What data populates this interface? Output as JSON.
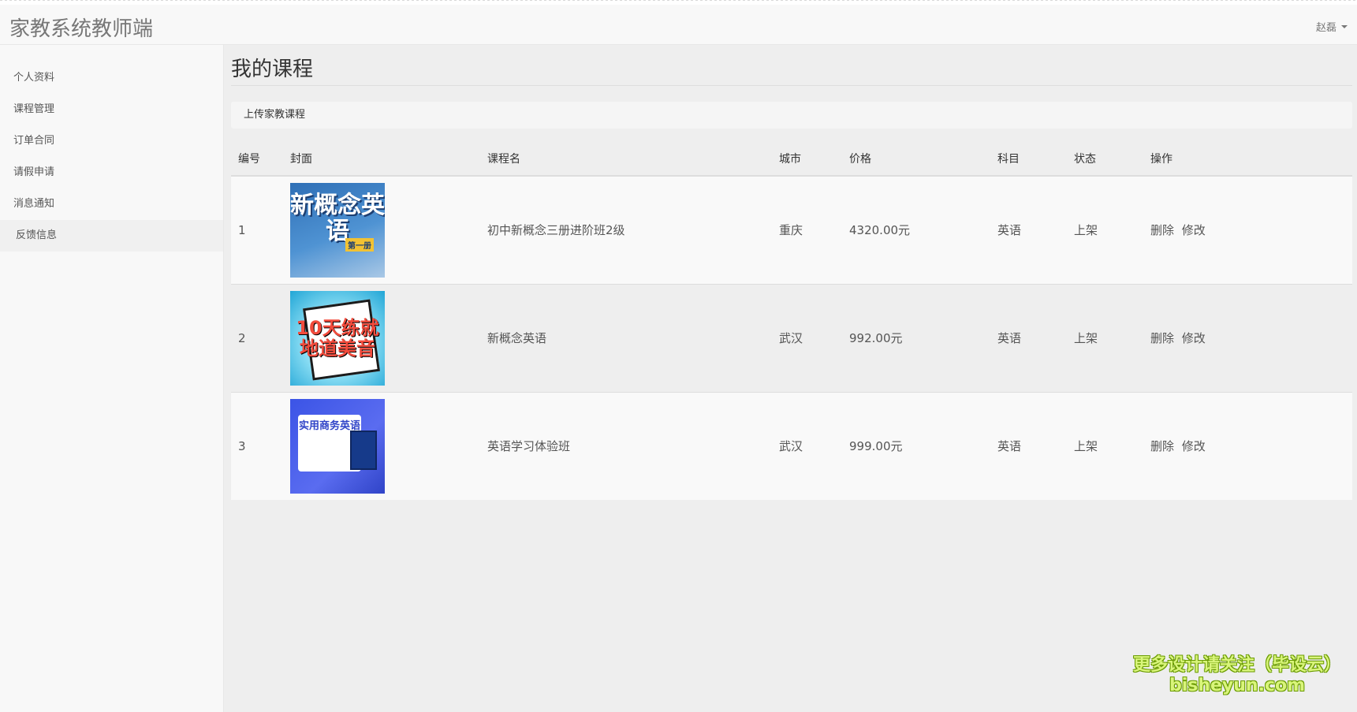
{
  "app": {
    "brand": "家教系统教师端",
    "user": "赵磊"
  },
  "sidebar": {
    "items": [
      {
        "label": "个人资料"
      },
      {
        "label": "课程管理"
      },
      {
        "label": "订单合同"
      },
      {
        "label": "请假申请"
      },
      {
        "label": "消息通知"
      },
      {
        "label": "反馈信息"
      }
    ]
  },
  "main": {
    "title": "我的课程",
    "breadcrumb": "上传家教课程",
    "table": {
      "headers": [
        "编号",
        "封面",
        "课程名",
        "城市",
        "价格",
        "科目",
        "状态",
        "操作"
      ],
      "rows": [
        {
          "id": "1",
          "cover_text": "新概念英语",
          "cover_tag": "第一册",
          "name": "初中新概念三册进阶班2级",
          "city": "重庆",
          "price": "4320.00元",
          "subject": "英语",
          "status": "上架",
          "delete": "删除",
          "edit": "修改"
        },
        {
          "id": "2",
          "cover_text": "10天练就地道美音",
          "name": "新概念英语",
          "city": "武汉",
          "price": "992.00元",
          "subject": "英语",
          "status": "上架",
          "delete": "删除",
          "edit": "修改"
        },
        {
          "id": "3",
          "cover_text": "实用商务英语",
          "name": "英语学习体验班",
          "city": "武汉",
          "price": "999.00元",
          "subject": "英语",
          "status": "上架",
          "delete": "删除",
          "edit": "修改"
        }
      ]
    }
  },
  "watermark": {
    "line1": "更多设计请关注（毕设云）",
    "line2": "bisheyun.com"
  }
}
